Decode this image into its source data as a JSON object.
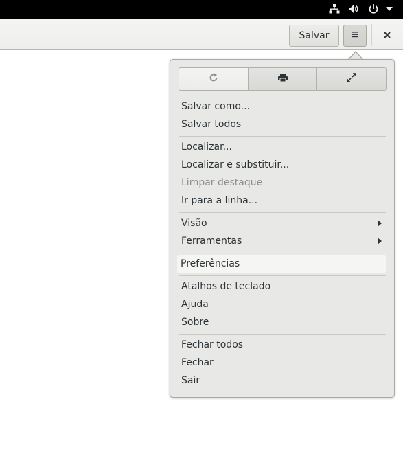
{
  "system_bar": {
    "icons": [
      "network-wired-icon",
      "volume-icon",
      "power-icon",
      "chevron-down-icon"
    ]
  },
  "header": {
    "save_label": "Salvar",
    "menu_icon": "hamburger-icon",
    "close_icon": "close-icon"
  },
  "popover": {
    "toolbar_icons": [
      "reload-icon",
      "print-icon",
      "fullscreen-icon"
    ],
    "groups": [
      [
        {
          "label": "Salvar como..."
        },
        {
          "label": "Salvar todos"
        }
      ],
      [
        {
          "label": "Localizar..."
        },
        {
          "label": "Localizar e substituir..."
        },
        {
          "label": "Limpar destaque",
          "disabled": true
        },
        {
          "label": "Ir para a linha..."
        }
      ],
      [
        {
          "label": "Visão",
          "submenu": true
        },
        {
          "label": "Ferramentas",
          "submenu": true
        }
      ],
      [
        {
          "label": "Preferências",
          "highlighted": true
        }
      ],
      [
        {
          "label": "Atalhos de teclado"
        },
        {
          "label": "Ajuda"
        },
        {
          "label": "Sobre"
        }
      ],
      [
        {
          "label": "Fechar todos"
        },
        {
          "label": "Fechar"
        },
        {
          "label": "Sair"
        }
      ]
    ]
  },
  "colors": {
    "text": "#2e3436",
    "disabled_text": "#8b8e8f",
    "popover_bg": "#e8e8e7",
    "top_bar": "#000000"
  }
}
